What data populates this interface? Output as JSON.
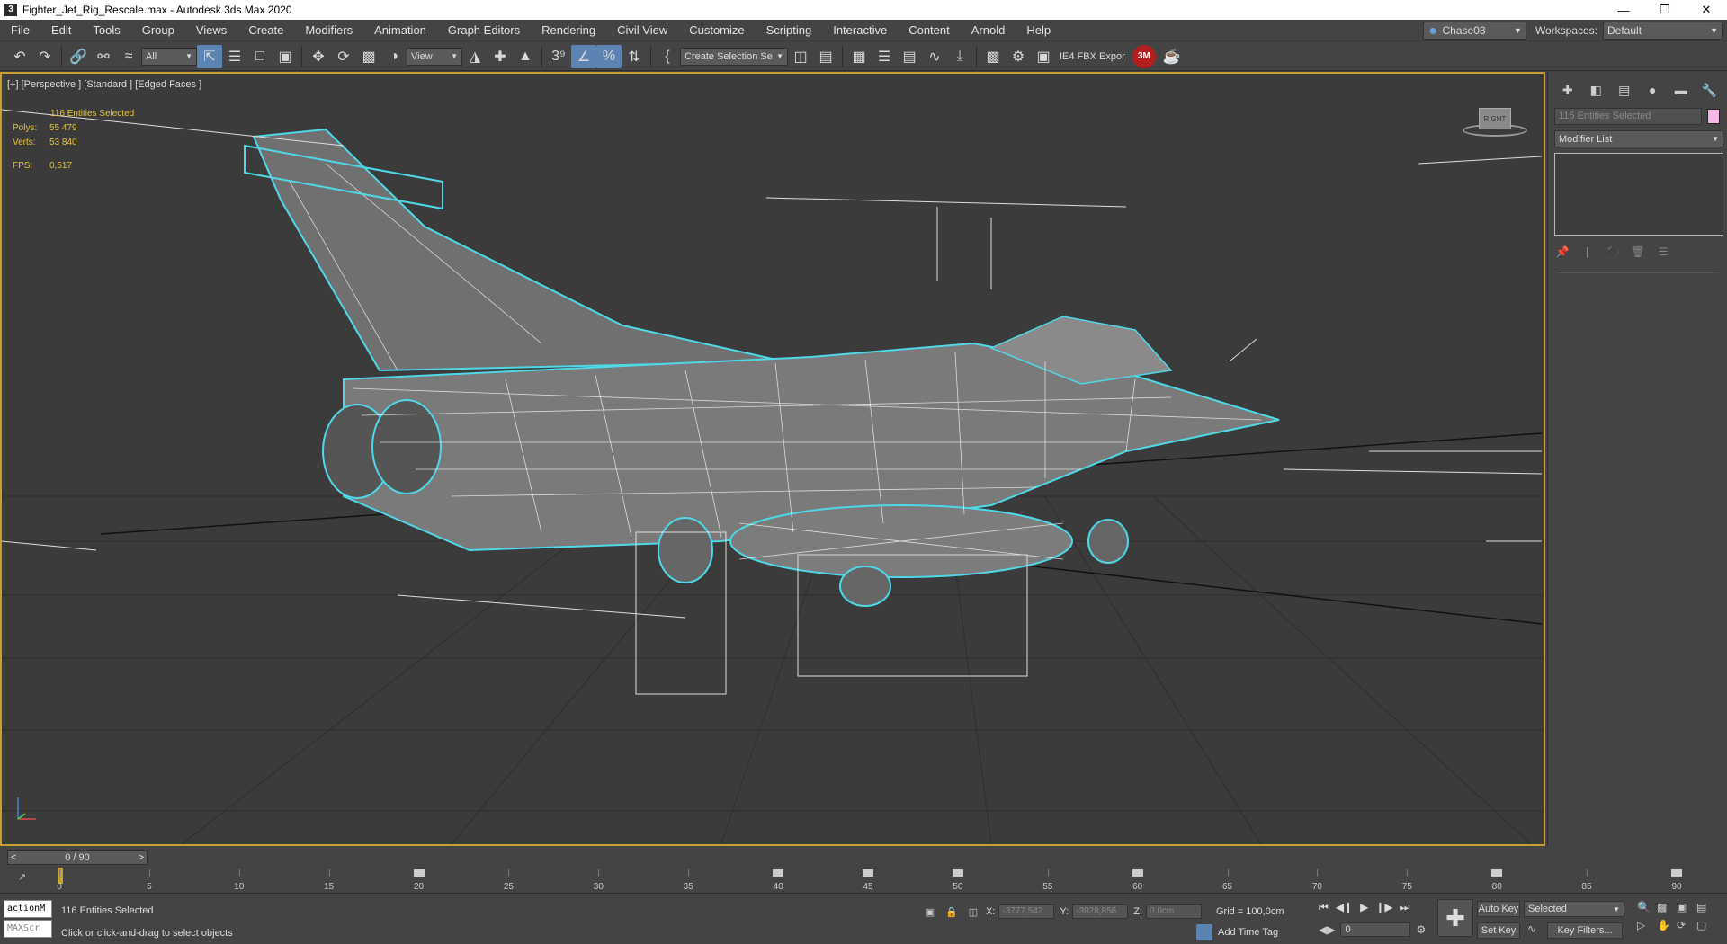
{
  "titlebar": {
    "title": "Fighter_Jet_Rig_Rescale.max - Autodesk 3ds Max 2020",
    "minimize": "—",
    "restore": "❐",
    "close": "✕"
  },
  "menu": {
    "items": [
      "File",
      "Edit",
      "Tools",
      "Group",
      "Views",
      "Create",
      "Modifiers",
      "Animation",
      "Graph Editors",
      "Rendering",
      "Civil View",
      "Customize",
      "Scripting",
      "Interactive",
      "Content",
      "Arnold",
      "Help"
    ],
    "user": "Chase03",
    "workspaces_label": "Workspaces:",
    "workspace_value": "Default"
  },
  "toolbar": {
    "filter_value": "All",
    "ref_coord_value": "View",
    "selection_set_placeholder": "Create Selection Se",
    "fbx_label": "IE4 FBX Expor",
    "render_badge": "3M"
  },
  "viewport": {
    "label": "[+] [Perspective ] [Standard ] [Edged Faces ]",
    "selection_text": "116 Entities Selected",
    "stats": [
      {
        "key": "Polys:",
        "value": "55 479"
      },
      {
        "key": "Verts:",
        "value": "53 840"
      }
    ],
    "fps_key": "FPS:",
    "fps_value": "0,517",
    "viewcube_label": "RIGHT"
  },
  "command_panel": {
    "selection_field": "116 Entities Selected",
    "modifier_list": "Modifier List",
    "swatch_color": "#f4b8e6"
  },
  "timeline": {
    "slider_text": "0 / 90",
    "prev": "<",
    "next": ">",
    "ticks": [
      "0",
      "5",
      "10",
      "15",
      "20",
      "25",
      "30",
      "35",
      "40",
      "45",
      "50",
      "55",
      "60",
      "65",
      "70",
      "75",
      "80",
      "85",
      "90"
    ]
  },
  "status": {
    "maxscript_line1": "actionM",
    "maxscript_line2": "MAXScr",
    "selection": "116 Entities Selected",
    "prompt": "Click or click-and-drag to select objects",
    "x_label": "X:",
    "x_value": "-3777,542",
    "y_label": "Y:",
    "y_value": "-3928,856",
    "z_label": "Z:",
    "z_value": "0,0cm",
    "grid": "Grid = 100,0cm",
    "add_time_tag": "Add Time Tag",
    "frame_value": "0",
    "auto_key": "Auto Key",
    "set_key": "Set Key",
    "key_mode": "Selected",
    "key_filters": "Key Filters..."
  },
  "colors": {
    "viewport_border": "#c8a032",
    "selection_outline": "#4fd8e8",
    "stats_text": "#e8c43c",
    "active_tool": "#5b84b3"
  }
}
